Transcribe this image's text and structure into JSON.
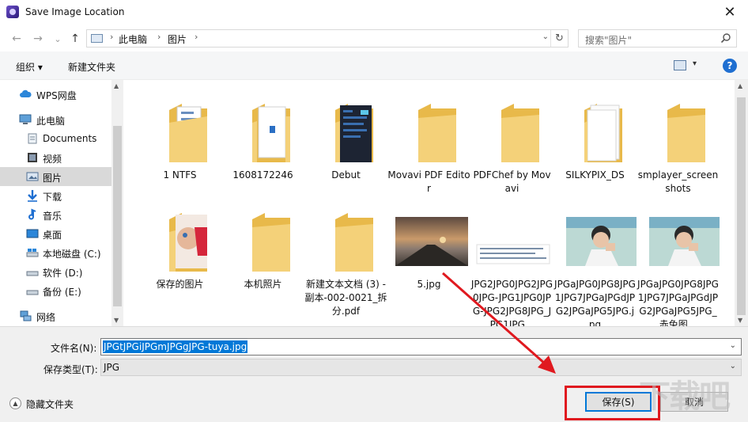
{
  "window": {
    "title": "Save Image Location",
    "close": "✕"
  },
  "nav": {
    "back": "←",
    "forward": "→",
    "recent": "⌄",
    "up": "↑",
    "breadcrumb": [
      "此电脑",
      "图片"
    ],
    "search_placeholder": "搜索\"图片\""
  },
  "toolbar": {
    "organize": "组织 ▾",
    "new_folder": "新建文件夹"
  },
  "sidebar": {
    "items": [
      {
        "label": "WPS网盘",
        "icon": "cloud-icon"
      },
      {
        "label": "此电脑",
        "icon": "computer-icon"
      },
      {
        "label": "Documents",
        "icon": "documents-icon"
      },
      {
        "label": "视频",
        "icon": "video-icon"
      },
      {
        "label": "图片",
        "icon": "pictures-icon",
        "selected": true
      },
      {
        "label": "下载",
        "icon": "download-icon"
      },
      {
        "label": "音乐",
        "icon": "music-icon"
      },
      {
        "label": "桌面",
        "icon": "desktop-icon"
      },
      {
        "label": "本地磁盘 (C:)",
        "icon": "drive-icon"
      },
      {
        "label": "软件 (D:)",
        "icon": "drive-icon"
      },
      {
        "label": "备份 (E:)",
        "icon": "drive-icon"
      },
      {
        "label": "网络",
        "icon": "network-icon"
      }
    ]
  },
  "files": [
    {
      "label": "1 NTFS",
      "kind": "folder-doc"
    },
    {
      "label": "1608172246",
      "kind": "folder-file"
    },
    {
      "label": "Debut",
      "kind": "folder-screen"
    },
    {
      "label": "Movavi PDF Editor",
      "kind": "folder"
    },
    {
      "label": "PDFChef by Movavi",
      "kind": "folder"
    },
    {
      "label": "SILKYPIX_DS",
      "kind": "folder-paper"
    },
    {
      "label": "smplayer_screenshots",
      "kind": "folder"
    },
    {
      "label": "保存的图片",
      "kind": "folder-photo"
    },
    {
      "label": "本机照片",
      "kind": "folder"
    },
    {
      "label": "新建文本文档 (3) - 副本-002-0021_拆分.pdf",
      "kind": "folder"
    },
    {
      "label": "5.jpg",
      "kind": "image-sunset"
    },
    {
      "label": "JPG2JPG0JPG2JPG0JPG-JPG1JPG0JPG-JPG2JPG8JPG_JPG1JPG...",
      "kind": "image-strip"
    },
    {
      "label": "JPGaJPG0JPG8JPG1JPG7JPGaJPGdJPG2JPGaJPG5JPG.jpg",
      "kind": "image-boy"
    },
    {
      "label": "JPGaJPG0JPG8JPG1JPG7JPGaJPGdJPG2JPGaJPG5JPG_赤兔图...",
      "kind": "image-boy"
    }
  ],
  "form": {
    "filename_label": "文件名(N):",
    "filename_value": "JPGtJPGiJPGmJPGgJPG-tuya.jpg",
    "type_label": "保存类型(T):",
    "type_value": "JPG"
  },
  "footer": {
    "hide_folders": "隐藏文件夹",
    "save": "保存(S)",
    "cancel": "取消"
  },
  "watermark": "下载吧"
}
